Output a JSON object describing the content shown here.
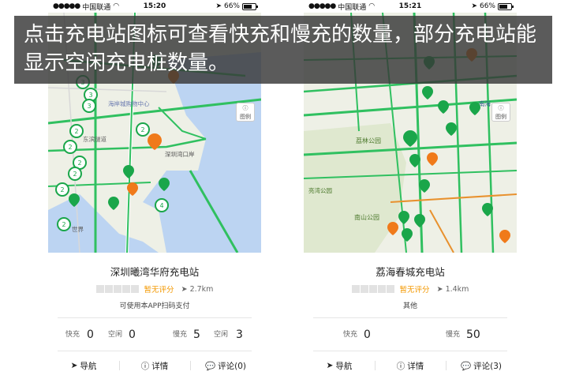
{
  "overlay": {
    "caption": "点击充电站图标可查看快充和慢充的数量，部分充电站能显示空闲充电桩数量。"
  },
  "colors": {
    "green": "#1aa64a",
    "orange": "#f07a1a",
    "road": "#30c060",
    "water": "#bcd4f2",
    "overlay": "#373737"
  },
  "left": {
    "status": {
      "carrier": "中国联通",
      "time": "15:20",
      "battery": "66%"
    },
    "map": {
      "labels": [
        "海岸城购物中心",
        "东滨隧道",
        "深圳湾口岸",
        "世界"
      ],
      "cluster_counts": [
        "3",
        "3",
        "3",
        "2",
        "2",
        "2",
        "2",
        "2",
        "2",
        "4",
        "2"
      ],
      "legend_label": "图例"
    },
    "station": {
      "name": "深圳曦湾华府充电站",
      "rating": "暂无评分",
      "distance": "2.7km",
      "note": "可使用本APP扫码支付",
      "fast_label": "快充",
      "fast": "0",
      "fast_free_label": "空闲",
      "fast_free": "0",
      "slow_label": "慢充",
      "slow": "5",
      "slow_free_label": "空闲",
      "slow_free": "3"
    },
    "actions": {
      "nav": "导航",
      "detail": "详情",
      "review": "评论(0)"
    }
  },
  "right": {
    "status": {
      "carrier": "中国联通",
      "time": "15:21",
      "battery": "66%"
    },
    "map": {
      "labels": [
        "荔林公园",
        "亮湾公园",
        "南山公园",
        "南海"
      ],
      "legend_label": "图例"
    },
    "station": {
      "name": "荔海春城充电站",
      "rating": "暂无评分",
      "distance": "1.4km",
      "note": "其他",
      "fast_label": "快充",
      "fast": "0",
      "slow_label": "慢充",
      "slow": "50"
    },
    "actions": {
      "nav": "导航",
      "detail": "详情",
      "review": "评论(3)"
    }
  }
}
